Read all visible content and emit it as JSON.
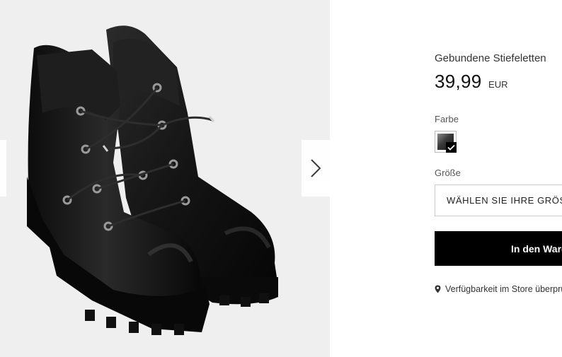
{
  "product": {
    "name": "Gebundene Stiefeletten",
    "price": "39,99",
    "currency": "EUR",
    "image_alt": "Black lace-up ankle boots"
  },
  "color_section": {
    "label": "Farbe",
    "selected_swatch": {
      "icon": "check-icon",
      "colors": [
        "#8a8a8a",
        "#111111"
      ]
    }
  },
  "size_section": {
    "label": "Größe",
    "placeholder": "WÄHLEN SIE IHRE GRÖSSE"
  },
  "add_to_cart": {
    "label": "In den Warenkorb",
    "icon": "shopping-bag-icon"
  },
  "store_availability": {
    "label": "Verfügbarkeit im Store überprüfen",
    "icon": "location-pin-icon"
  },
  "gallery": {
    "next_icon": "chevron-right-icon",
    "prev_icon": "chevron-left-icon"
  }
}
